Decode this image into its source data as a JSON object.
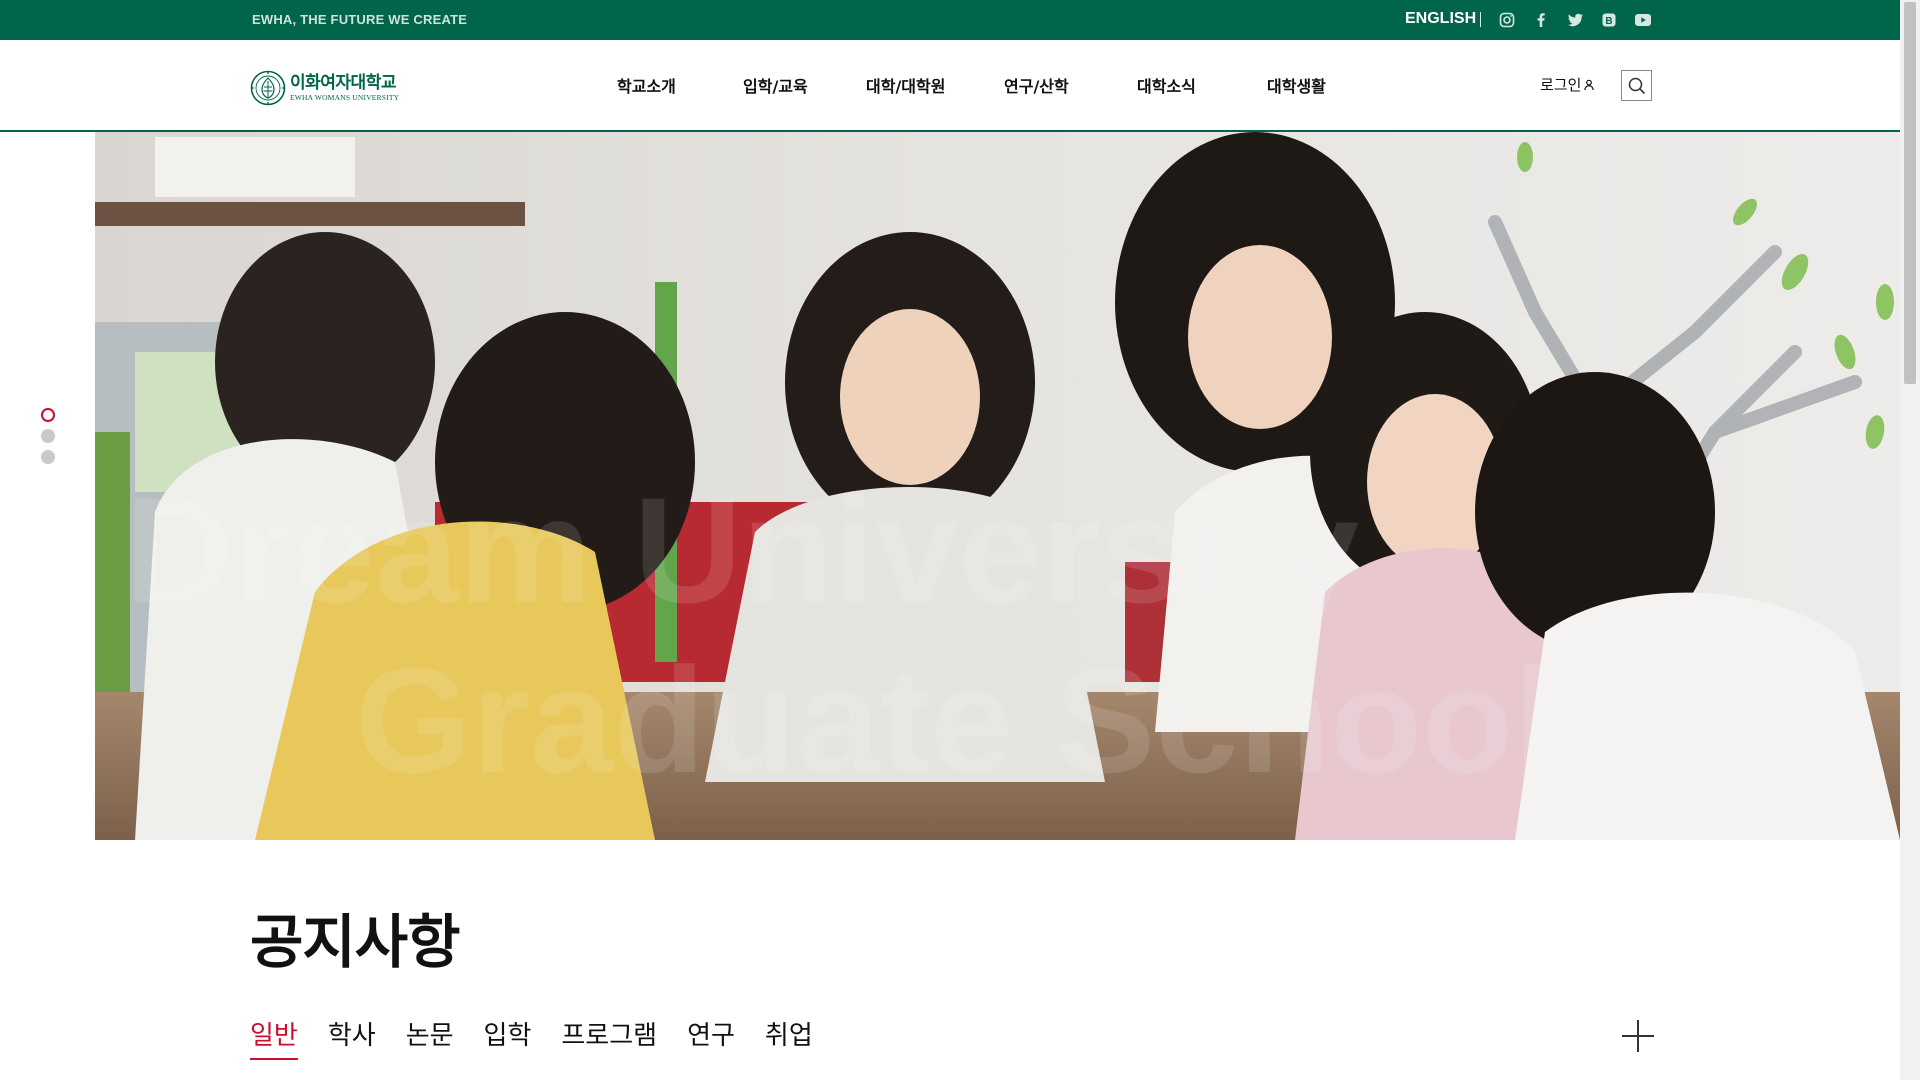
{
  "topbar": {
    "slogan": "EWHA, THE FUTURE WE CREATE",
    "language": "ENGLISH",
    "social": [
      "instagram-icon",
      "facebook-icon",
      "twitter-icon",
      "blog-icon",
      "youtube-icon"
    ]
  },
  "header": {
    "logo": {
      "korean": "이화여자대학교",
      "english": "EWHA WOMANS UNIVERSITY"
    },
    "nav": [
      "학교소개",
      "입학/교육",
      "대학/대학원",
      "연구/산학",
      "대학소식",
      "대학생활"
    ],
    "login": "로그인",
    "search_icon": "search-icon"
  },
  "hero": {
    "slide_count": 3,
    "active_slide": 1,
    "overlay_text": [
      "Dream University",
      "Graduate School"
    ]
  },
  "notices": {
    "title": "공지사항",
    "tabs": [
      "일반",
      "학사",
      "논문",
      "입학",
      "프로그램",
      "연구",
      "취업"
    ],
    "active_tab": "일반",
    "more_icon": "plus-icon"
  },
  "colors": {
    "brand_green": "#00654b",
    "accent_red": "#c8102e"
  }
}
